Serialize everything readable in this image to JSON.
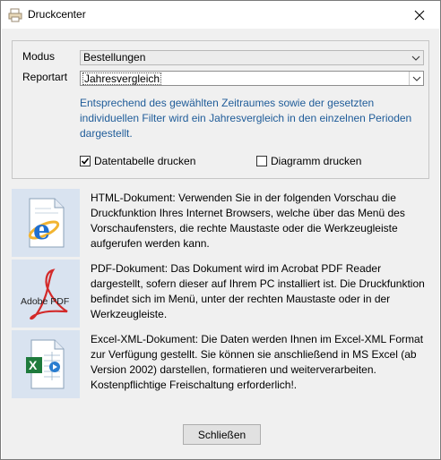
{
  "window": {
    "title": "Druckcenter"
  },
  "form": {
    "modus_label": "Modus",
    "modus_value": "Bestellungen",
    "reportart_label": "Reportart",
    "reportart_value": "Jahresvergleich",
    "description": "Entsprechend des gewählten Zeitraumes sowie der gesetzten individuellen Filter wird ein Jahresvergleich in den einzelnen Perioden dargestellt.",
    "check_table_label": "Datentabelle drucken",
    "check_table_checked": true,
    "check_chart_label": "Diagramm drucken",
    "check_chart_checked": false
  },
  "documents": [
    {
      "icon": "html-document-icon",
      "text": "HTML-Dokument: Verwenden Sie in der folgenden Vorschau die Druckfunktion Ihres Internet Browsers, welche über das Menü des Vorschaufensters, die rechte Maustaste oder die Werkzeugleiste aufgerufen werden kann."
    },
    {
      "icon": "pdf-document-icon",
      "icon_text": "Adobe PDF",
      "text": "PDF-Dokument: Das Dokument wird im Acrobat PDF Reader dargestellt, sofern dieser auf Ihrem PC installiert ist. Die Druckfunktion befindet sich im Menü, unter der rechten Maustaste oder in der Werkzeugleiste."
    },
    {
      "icon": "excel-document-icon",
      "text": "Excel-XML-Dokument: Die Daten werden Ihnen im Excel-XML Format zur Verfügung gestellt. Sie können sie anschließend in MS Excel (ab Version 2002) darstellen, formatieren und weiterverarbeiten. Kostenpflichtige Freischaltung erforderlich!."
    }
  ],
  "footer": {
    "close_label": "Schließen"
  },
  "colors": {
    "description_text": "#1f5c99",
    "dialog_background": "#f0f0f0",
    "icon_background": "#d9e3f0"
  }
}
